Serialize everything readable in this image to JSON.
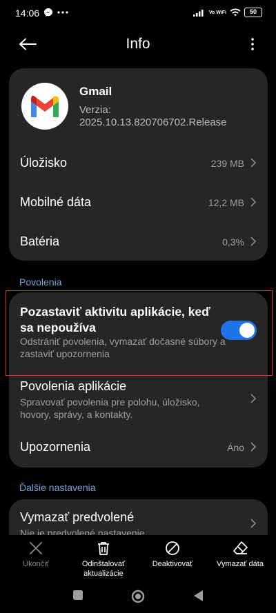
{
  "status_bar": {
    "time": "14:06",
    "battery": "50",
    "network_label": "Vo WiFi"
  },
  "header": {
    "title": "Info"
  },
  "app": {
    "name": "Gmail",
    "version_label": "Verzia:",
    "version": "2025.10.13.820706702.Release"
  },
  "info_rows": [
    {
      "label": "Úložisko",
      "value": "239 MB"
    },
    {
      "label": "Mobilné dáta",
      "value": "12,2 MB"
    },
    {
      "label": "Batéria",
      "value": "0,3%"
    }
  ],
  "permissions_section": {
    "heading": "Povolenia",
    "pause_activity": {
      "title": "Pozastaviť aktivitu aplikácie, keď sa nepoužíva",
      "subtitle": "Odstrániť povolenia, vymazať dočasné súbory a zastaviť upozornenia",
      "enabled": true
    },
    "app_permissions": {
      "title": "Povolenia aplikácie",
      "subtitle": "Spravovať povolenia pre polohu, úložisko, hovory, správy, a kontakty."
    },
    "notifications": {
      "title": "Upozornenia",
      "value": "Áno"
    }
  },
  "more_section": {
    "heading": "Ďalšie nastavenia",
    "clear_defaults": {
      "title": "Vymazať predvolené",
      "subtitle": "Nie je predvolené nastavenie."
    }
  },
  "bottom_actions": [
    {
      "label": "Ukončiť",
      "icon": "close-icon",
      "enabled": false
    },
    {
      "label": "Odinštalovať aktualizácie",
      "icon": "trash-icon",
      "enabled": true
    },
    {
      "label": "Deaktivovať",
      "icon": "disable-icon",
      "enabled": true
    },
    {
      "label": "Vymazať dáta",
      "icon": "eraser-icon",
      "enabled": true
    }
  ],
  "colors": {
    "background": "#000000",
    "card": "#262626",
    "accent": "#1e73e8",
    "section_label": "#7aa3d6",
    "highlight": "#d13a3a"
  }
}
